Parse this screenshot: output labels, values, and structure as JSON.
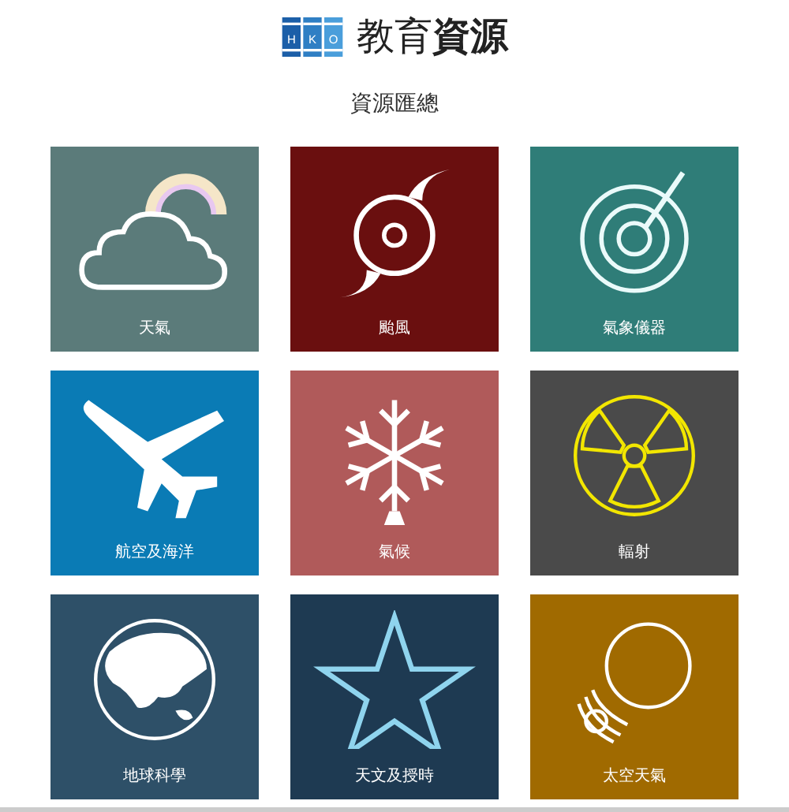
{
  "logo": {
    "letters": [
      "H",
      "K",
      "O"
    ]
  },
  "title": "教育**資源**",
  "subtitle": "資源匯總",
  "tiles": [
    {
      "label": "天氣",
      "kind": "cloud",
      "color": "#5b7b7a"
    },
    {
      "label": "颱風",
      "kind": "typhoon",
      "color": "#6a0f0f"
    },
    {
      "label": "氣象儀器",
      "kind": "radar",
      "color": "#2f7d78"
    },
    {
      "label": "航空及海洋",
      "kind": "plane",
      "color": "#0a7bb5"
    },
    {
      "label": "氣候",
      "kind": "snowflake",
      "color": "#b05a5a"
    },
    {
      "label": "輻射",
      "kind": "radiation",
      "color": "#4a4a4a"
    },
    {
      "label": "地球科學",
      "kind": "globe",
      "color": "#2e5068"
    },
    {
      "label": "天文及授時",
      "kind": "star",
      "color": "#1e3a52"
    },
    {
      "label": "太空天氣",
      "kind": "sun",
      "color": "#a06a00"
    }
  ]
}
